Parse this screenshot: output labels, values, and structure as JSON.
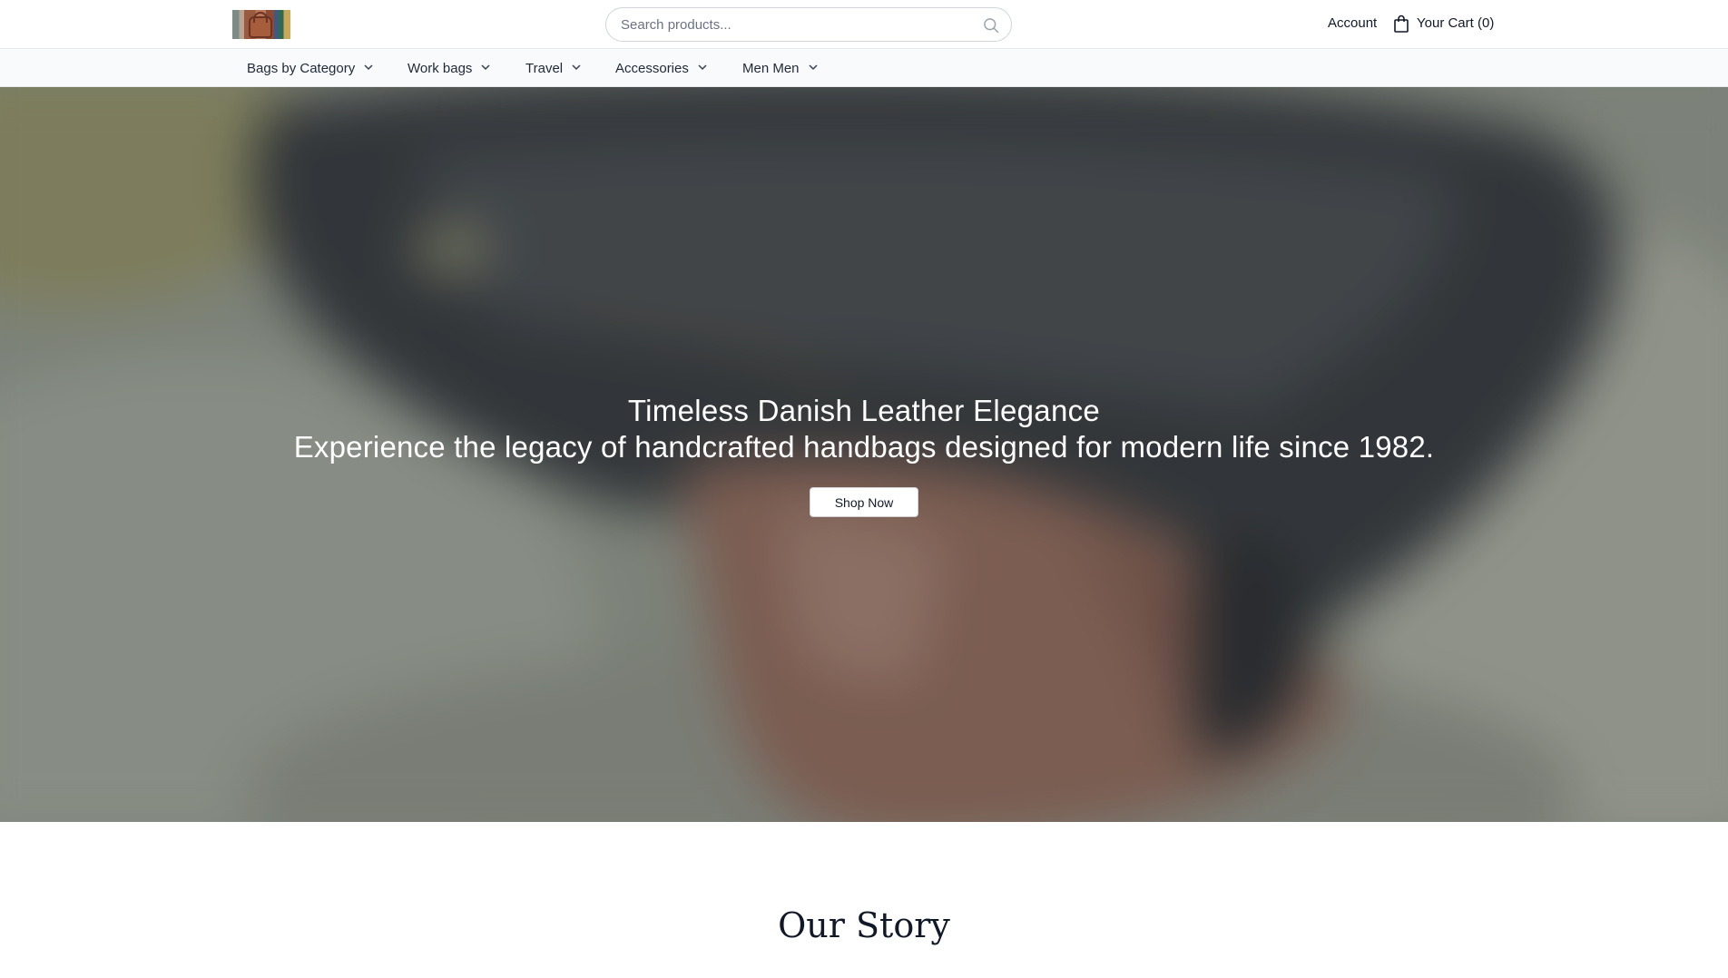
{
  "header": {
    "logo_alt": "Store logo",
    "search": {
      "placeholder": "Search products...",
      "value": ""
    },
    "account_label": "Account",
    "cart_label": "Your Cart (0)"
  },
  "nav": {
    "items": [
      {
        "label": "Bags by Category",
        "icon": "chevron-down-icon"
      },
      {
        "label": "Work bags",
        "icon": "chevron-down-icon"
      },
      {
        "label": "Travel",
        "icon": "chevron-down-icon"
      },
      {
        "label": "Accessories",
        "icon": "chevron-down-icon"
      },
      {
        "label": "Men Men",
        "icon": "chevron-down-icon"
      }
    ]
  },
  "hero": {
    "title": "Timeless Danish Leather Elegance",
    "subtitle": "Experience the legacy of handcrafted handbags designed for modern life since 1982.",
    "cta_label": "Shop Now"
  },
  "story": {
    "title": "Our Story"
  },
  "colors": {
    "nav_bg": "#f9fafb",
    "border": "#e5e7eb",
    "hero_text": "#ffffff",
    "button_bg": "#ffffff"
  }
}
